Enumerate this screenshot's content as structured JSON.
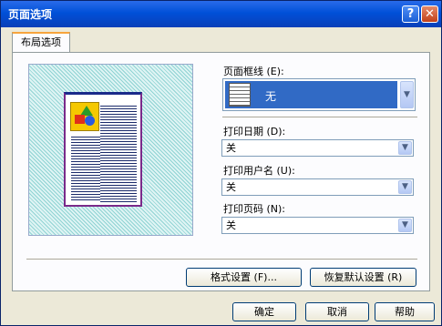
{
  "window": {
    "title": "页面选项",
    "help_label": "?",
    "close_label": "✕"
  },
  "tabs": [
    {
      "label": "布局选项"
    }
  ],
  "preview": {
    "icon": "page-preview"
  },
  "fields": {
    "border": {
      "label": "页面框线 (E):",
      "value": "无"
    },
    "date": {
      "label": "打印日期 (D):",
      "value": "关"
    },
    "user": {
      "label": "打印用户名 (U):",
      "value": "关"
    },
    "page_number": {
      "label": "打印页码 (N):",
      "value": "关"
    }
  },
  "buttons": {
    "format": "格式设置 (F)...",
    "restore": "恢复默认设置 (R)",
    "ok": "确定",
    "cancel": "取消",
    "help": "帮助"
  },
  "icons": {
    "dropdown": "chevron-down-icon"
  }
}
